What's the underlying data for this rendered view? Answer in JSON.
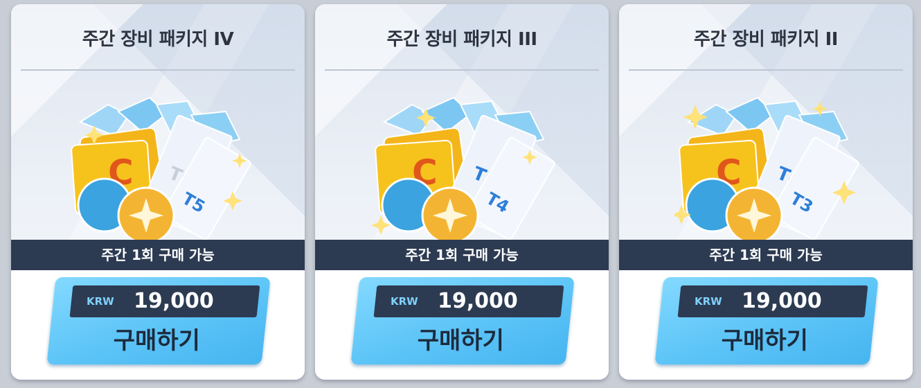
{
  "packages": [
    {
      "title": "주간 장비 패키지 IV",
      "limit": "주간 1회 구매 가능",
      "currency": "KRW",
      "price": "19,000",
      "buy_label": "구매하기",
      "ticket_labels": [
        "T6",
        "T5"
      ]
    },
    {
      "title": "주간 장비 패키지 III",
      "limit": "주간 1회 구매 가능",
      "currency": "KRW",
      "price": "19,000",
      "buy_label": "구매하기",
      "ticket_labels": [
        "T5",
        "T4"
      ]
    },
    {
      "title": "주간 장비 패키지 II",
      "limit": "주간 1회 구매 가능",
      "currency": "KRW",
      "price": "19,000",
      "buy_label": "구매하기",
      "ticket_labels": [
        "T4",
        "T3"
      ]
    }
  ],
  "card_letter": "C",
  "colors": {
    "banner": "#2c3b52",
    "button": "#5cc4f7",
    "card_gold": "#f6c21c",
    "ticket_blue": "#2e7fd8"
  }
}
